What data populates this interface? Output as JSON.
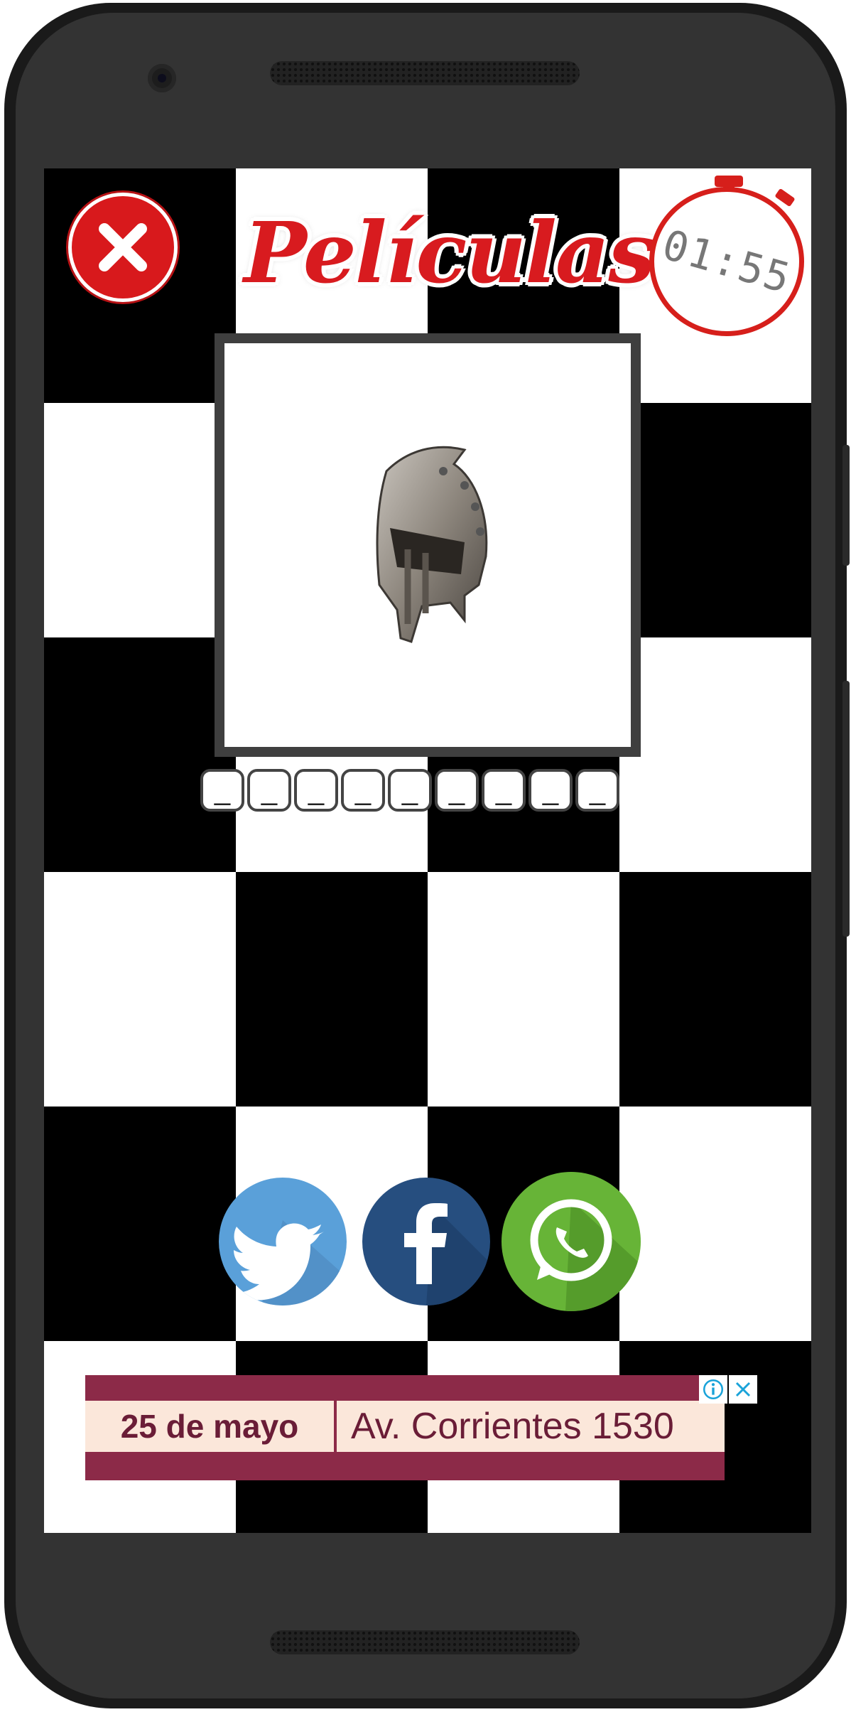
{
  "header": {
    "title": "Películas",
    "timer": "01:55"
  },
  "puzzle": {
    "image_subject": "gladiator-helmet",
    "letter_slots": [
      "_",
      "_",
      "_",
      "_",
      "_",
      "_",
      "_",
      "_",
      "_"
    ]
  },
  "share": {
    "items": [
      {
        "name": "twitter",
        "icon": "twitter-bird-icon",
        "color": "#5aa0d9"
      },
      {
        "name": "facebook",
        "icon": "facebook-f-icon",
        "color": "#264e7f"
      },
      {
        "name": "whatsapp",
        "icon": "whatsapp-phone-icon",
        "color": "#67b437"
      }
    ]
  },
  "ad": {
    "left_text": "25 de mayo",
    "right_text": "Av. Corrientes 1530",
    "info_icon": "info-icon",
    "close_icon": "close-icon"
  },
  "colors": {
    "accent_red": "#d81b1f",
    "frame_gray": "#3f3f3f",
    "ad_bar": "#8c2a48"
  }
}
